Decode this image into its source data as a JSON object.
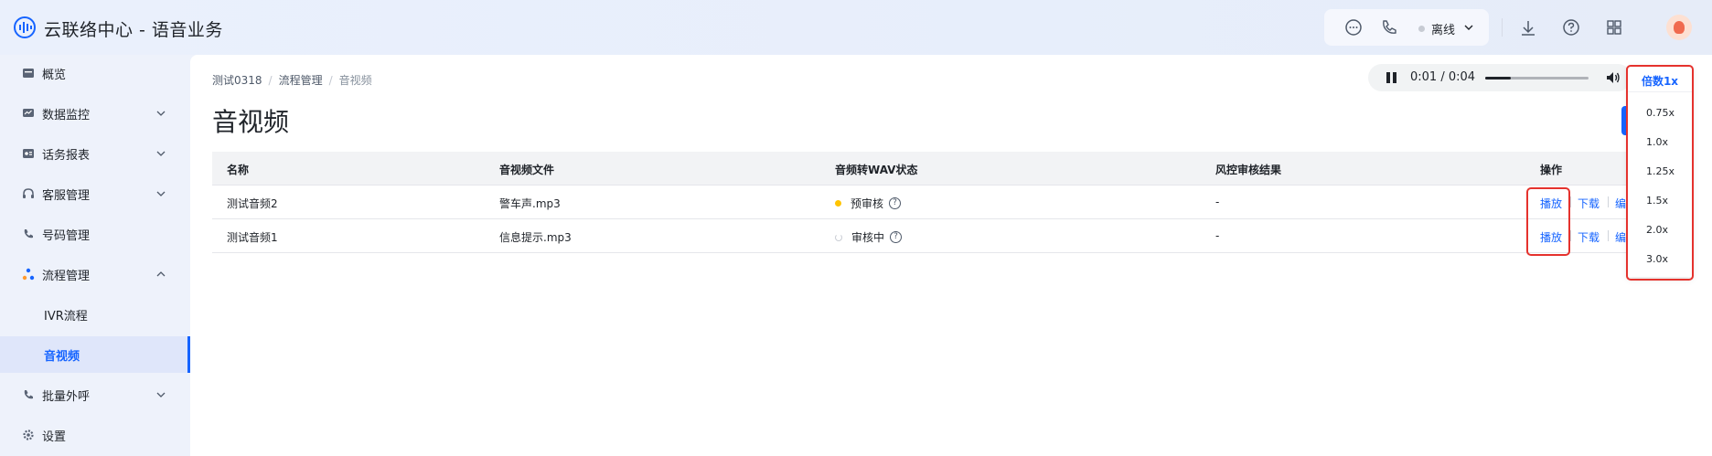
{
  "header": {
    "title": "云联络中心 - 语音业务",
    "status": "离线",
    "icons": [
      "chat-icon",
      "phone-icon",
      "download-icon",
      "help-icon",
      "apps-grid-icon"
    ]
  },
  "sidebar": {
    "items": [
      {
        "label": "概览",
        "icon": "overview-icon"
      },
      {
        "label": "数据监控",
        "icon": "monitor-icon",
        "chevron": "down"
      },
      {
        "label": "话务报表",
        "icon": "report-icon",
        "chevron": "down"
      },
      {
        "label": "客服管理",
        "icon": "headset-icon",
        "chevron": "down"
      },
      {
        "label": "号码管理",
        "icon": "phone-icon"
      },
      {
        "label": "流程管理",
        "icon": "flow-icon",
        "chevron": "up"
      },
      {
        "label": "IVR流程"
      },
      {
        "label": "音视频"
      },
      {
        "label": "批量外呼",
        "icon": "outbound-icon",
        "chevron": "down"
      },
      {
        "label": "设置",
        "icon": "gear-icon"
      }
    ]
  },
  "breadcrumb": [
    "测试0318",
    "流程管理",
    "音视频"
  ],
  "page_title": "音视频",
  "player": {
    "time": "0:01 / 0:04",
    "progress_fraction": 0.25
  },
  "table": {
    "columns": [
      "名称",
      "音视频文件",
      "音频转WAV状态",
      "风控审核结果",
      "操作"
    ],
    "rows": [
      {
        "name": "测试音频2",
        "file": "警车声.mp3",
        "status": "预审核",
        "status_kind": "dot",
        "risk": "-",
        "actions": [
          "播放",
          "下载",
          "编"
        ]
      },
      {
        "name": "测试音频1",
        "file": "信息提示.mp3",
        "status": "审核中",
        "status_kind": "spin",
        "risk": "-",
        "actions": [
          "播放",
          "下载",
          "编"
        ]
      }
    ]
  },
  "speed_menu": {
    "header": "倍数1x",
    "options": [
      "0.75x",
      "1.0x",
      "1.25x",
      "1.5x",
      "2.0x",
      "3.0x"
    ]
  },
  "colors": {
    "accent": "#1664ff",
    "annotation": "#e5322d",
    "pending_dot": "#ffc400"
  }
}
